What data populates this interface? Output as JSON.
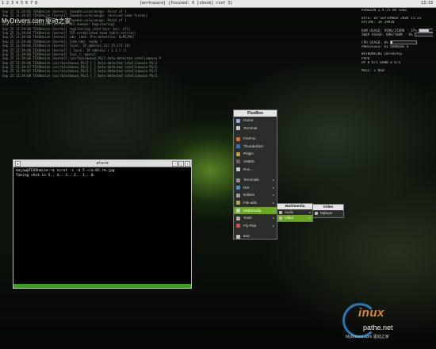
{
  "topbar": {
    "left": "1  2  3  4  5  6  7  8",
    "center": "[workspace] [focused: 6  [sbook] rxvt  3]",
    "clock": "13:33"
  },
  "log_lines": [
    "Sep 25 11:39:05 TEXOhmize [kernel] [hwaddr=cole/unnge: Point of ]",
    "Sep 25 11:39:05 TEXOhmize [kernel] [hwaddr=cole/unnge: received name fields]",
    "Sep 25 11:39:05 TEXOhmize [kernel] [hwaddr=cole/unnge: Point of ]",
    "Sep 25 11:39:05 TEXOhmize [kernel] NFS daemon: Registering]",
    "Sep 25 11:39:06 TEXOhmize [kernel] registering interface: bus: nfs]",
    "Sep 25 11:39:06 TEXOhmize [kernel] TCP established hash table entries]",
    "Sep 25 11:39:06 TEXOhmize [kernel] ide: ide0: Pre-detection: DLMS/MA]",
    "Sep 25 11:39:06 TEXOhmize [kernel] [ide-nbd: ready ]",
    "Sep 25 11:39:06 TEXOhmize [kernel] local:  IP address 217.75.171.78]",
    "Sep 25 11:39:06 TEXOhmize [kernel] [  local:  IP address ( 1.1.1 )]",
    "Sep 25 11:39:06 TEXOhmize [kernel] [sys_r, query]",
    "Sep 25 11:39:06 TEXOhmize [kernel] /usr/bin/mouse_PS/2 Auto-detected intellimouse PS/2",
    "Sep 25 11:39:06 TEXOhmize /usr/bin/mouse_PS/2 [ ] Auto-detected intellimouse PS/2",
    "Sep 25 11:39:07 TEXOhmize /usr/bin/mouse_PS/2 [ ] Auto-detected intellimouse PS/2",
    "Sep 25 11:39:07 TEXOhmize /usr/bin/mouse_PS/2 [ ] Auto-detected intellimouse PS/2",
    "Sep 25 11:39:08 TEXOhmize /usr/bin/mouse_PS/2 [ ] Auto-detected intellimouse PS/2"
  ],
  "watermark_top": "MyDrivers.com 驱动之家",
  "sysinfo": {
    "lines": [
      "PENGUIN 2.4.25 ON i686",
      "",
      "DATE: ED SEPTEMBER 2004 13:33",
      "UPTIME: 3H 29MIN",
      "",
      "RAM USAGE: 95MB/250MB - 37%",
      "SWAP USAGE: 6MB/500M - 0%",
      "",
      "CPU USAGE: 8%",
      "PROCESSES: 81 RUNNING 0",
      "",
      "NETWORKING INTERFACE",
      "   PPP0",
      "   UP 0 K/S  DOWN 0 K/S",
      "",
      "MAIL: 1 NEW"
    ],
    "ram_pct": 0.37,
    "swap_pct": 0.0,
    "cpu_pct": 0.08
  },
  "terminal": {
    "title": "aterm",
    "lines": [
      "majaw@TEXOhmize:~$ scrot -c -d 5 ~/a-05.rk.jpg",
      "Taking shot in 5.. 4.. 3.. 2.. 1.. 0."
    ],
    "status_color": "#3aa01a"
  },
  "fluxbox": {
    "title": "FluxBox",
    "items": [
      {
        "label": "Home",
        "icon": "home-icon",
        "color": "#8ab0d8"
      },
      {
        "label": "Terminal",
        "icon": "terminal-icon",
        "color": "#c8c8c8"
      },
      {
        "label": "",
        "icon": "",
        "color": ""
      },
      {
        "label": "FireFox",
        "icon": "firefox-icon",
        "color": "#e07020"
      },
      {
        "label": "Thunderbird",
        "icon": "thunderbird-icon",
        "color": "#3a70c0"
      },
      {
        "label": "Pidgin",
        "icon": "pidgin-icon",
        "color": "#c8a040"
      },
      {
        "label": "XMMS",
        "icon": "xmms-icon",
        "color": "#606060"
      },
      {
        "label": "Run...",
        "icon": "run-icon",
        "color": "#c8c8c8"
      },
      {
        "label": "",
        "icon": "",
        "color": ""
      },
      {
        "label": "Terminals",
        "icon": "terminals-icon",
        "color": "#909090"
      },
      {
        "label": "Net",
        "icon": "net-icon",
        "color": "#5090c0"
      },
      {
        "label": "Editors",
        "icon": "editors-icon",
        "color": "#a0a0a0"
      },
      {
        "label": "File utils",
        "icon": "file-utils-icon",
        "color": "#c0a060"
      },
      {
        "label": "Multimedia",
        "icon": "multimedia-icon",
        "color": "#d0d0d0"
      },
      {
        "label": "Tools",
        "icon": "tools-icon",
        "color": "#b0b0b0"
      },
      {
        "label": "Fly Plus",
        "icon": "fly-plus-icon",
        "color": "#d05050"
      },
      {
        "label": "",
        "icon": "",
        "color": ""
      },
      {
        "label": "Exit",
        "icon": "exit-icon",
        "color": "#c0c0c0"
      }
    ],
    "submenu_flags": [
      false,
      false,
      false,
      false,
      false,
      false,
      false,
      false,
      false,
      true,
      true,
      true,
      true,
      true,
      true,
      true,
      false,
      false
    ],
    "selected": "Multimedia"
  },
  "multimedia_menu": {
    "title": "Multimedia",
    "items": [
      {
        "label": "Audio",
        "icon": "audio-icon"
      },
      {
        "label": "Video",
        "icon": "video-icon"
      }
    ],
    "selected": "Video"
  },
  "video_menu": {
    "title": "Video",
    "items": [
      {
        "label": "Mplayer",
        "icon": "mplayer-icon"
      }
    ]
  },
  "logo": {
    "text": "inux"
  },
  "watermark_bottom": "pathe.net",
  "watermark_bottom2": "MyDrivers.com  驱动之家",
  "colors": {
    "accent": "#6aa81e",
    "menu_bg": "#2b2d2b",
    "title_bg": "#e4e4e4"
  }
}
